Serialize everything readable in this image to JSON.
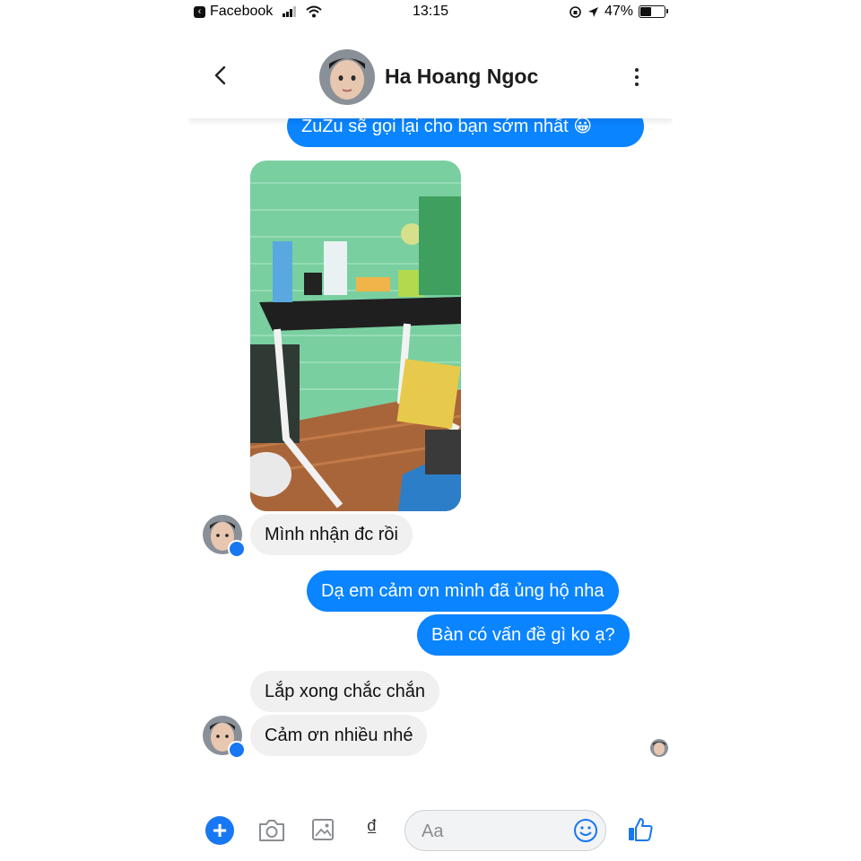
{
  "status_bar": {
    "back_app": "Facebook",
    "time": "13:15",
    "battery": "47%"
  },
  "header": {
    "contact_name": "Ha Hoang Ngoc"
  },
  "messages": {
    "partial_top": "ZuZu sẽ gọi lại cho bạn sớm nhất 😀",
    "in_1": "Mình nhận đc rồi",
    "out_1": "Dạ em cảm ơn mình đã ủng hộ nha",
    "out_2": "Bàn có vấn đề gì ko ạ?",
    "in_2": "Lắp xong chắc chắn",
    "in_3": "Cảm ơn nhiều nhé"
  },
  "composer": {
    "placeholder": "Aa",
    "currency_symbol": "₫"
  },
  "colors": {
    "outgoing_bubble": "#0a84ff",
    "incoming_bubble": "#f0f0f0",
    "accent": "#1877f2"
  }
}
